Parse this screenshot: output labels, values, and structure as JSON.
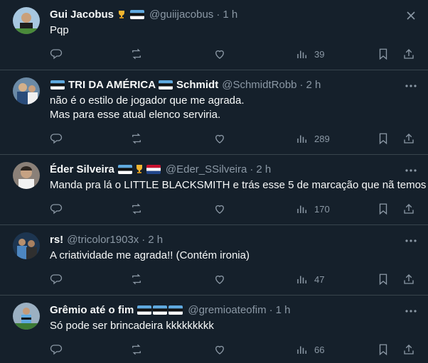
{
  "tweets": [
    {
      "name": "Gui Jacobus",
      "handle": "@guiijacobus",
      "time": "1 h",
      "text_lines": [
        "Pqp"
      ],
      "views": "39",
      "avatar_color": "#d9a24a"
    },
    {
      "name_left": "TRI DA AMÉRICA",
      "name_right": "Schmidt",
      "handle": "@SchmidtRobb",
      "time": "2 h",
      "text_lines": [
        "não é o estilo de jogador que me agrada.",
        "Mas para esse atual elenco serviria."
      ],
      "views": "289",
      "avatar_color": "#4f6f8f"
    },
    {
      "name": "Éder Silveira",
      "handle": "@Eder_SSilveira",
      "time": "2 h",
      "text_lines": [
        "Manda pra lá o LITTLE BLACKSMITH e trás esse 5 de marcação que nã temos"
      ],
      "views": "170",
      "avatar_color": "#6f6a63"
    },
    {
      "name": "rs!",
      "handle": "@tricolor1903x",
      "time": "2 h",
      "text_lines": [
        "A criatividade me agrada!! (Contém ironia)"
      ],
      "views": "47",
      "avatar_color": "#2f5070"
    },
    {
      "name": "Grêmio até o fim",
      "handle": "@gremioateofim",
      "time": "1 h",
      "text_lines": [
        "Só pode ser brincadeira kkkkkkkkk"
      ],
      "views": "66",
      "avatar_color": "#3d5f7a"
    }
  ],
  "colors": {
    "background": "#15202b",
    "divider": "#38444d",
    "muted": "#8b98a5",
    "flag_blue": "#5fa9df"
  }
}
